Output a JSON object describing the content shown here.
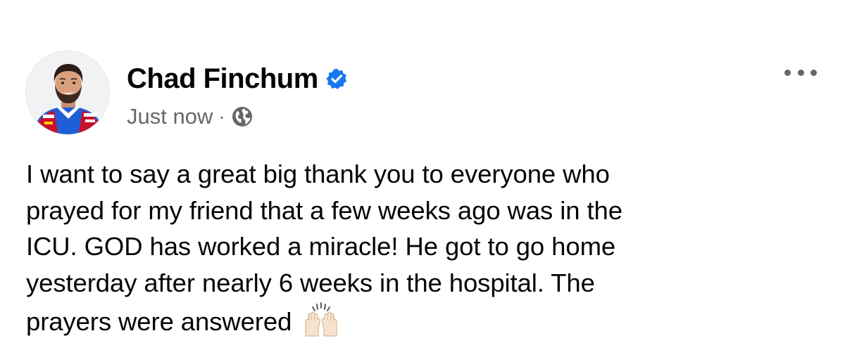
{
  "post": {
    "author": {
      "name": "Chad Finchum",
      "verified": true,
      "avatar": "driver-portrait-avatar"
    },
    "timestamp": "Just now",
    "separator": "·",
    "audience_icon": "globe-icon",
    "more_icon": "more-options-icon",
    "body_lines": [
      "I want to say a great big thank you to everyone who",
      "prayed for my friend that a few weeks ago was in the",
      "ICU. GOD has worked a miracle! He got to go home",
      "yesterday after nearly 6 weeks in the hospital. The",
      "prayers were answered"
    ],
    "trailing_emoji": "raised-hands-emoji"
  },
  "colors": {
    "text_primary": "#050505",
    "text_secondary": "#65676b",
    "verified_blue": "#1877f2"
  }
}
